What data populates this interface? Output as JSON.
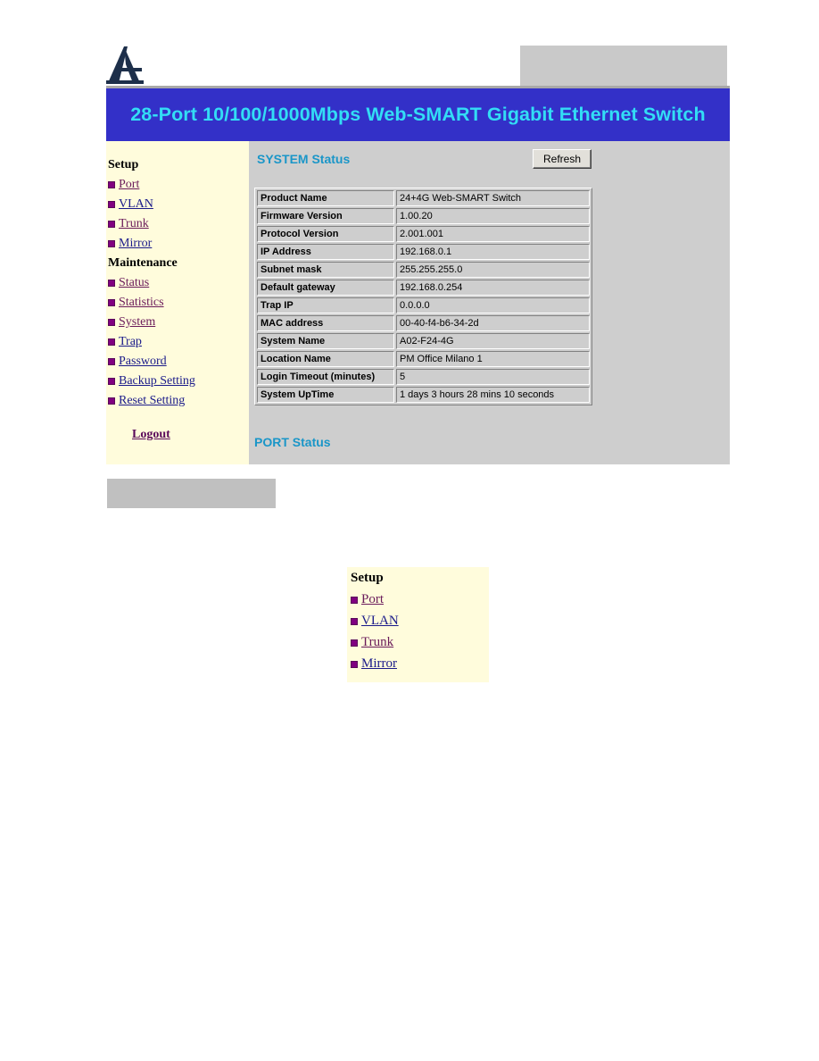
{
  "header": {
    "logo": "atlantis-land-logo",
    "title": "28-Port 10/100/1000Mbps Web-SMART Gigabit Ethernet Switch"
  },
  "colors": {
    "banner_bg": "#3330c8",
    "banner_text": "#33ddf5",
    "sidebar_bg": "#fffcdc",
    "main_bg": "#cecece",
    "section_title": "#1a96c8",
    "bullet": "#800080"
  },
  "sidebar": {
    "setup_heading": "Setup",
    "setup_items": [
      {
        "label": "Port"
      },
      {
        "label": "VLAN"
      },
      {
        "label": "Trunk"
      },
      {
        "label": "Mirror"
      }
    ],
    "maintenance_heading": "Maintenance",
    "maintenance_items": [
      {
        "label": "Status"
      },
      {
        "label": "Statistics"
      },
      {
        "label": "System"
      },
      {
        "label": "Trap"
      },
      {
        "label": "Password"
      },
      {
        "label": "Backup Setting"
      },
      {
        "label": "Reset Setting"
      }
    ],
    "logout_label": "Logout"
  },
  "main": {
    "system_status_title": "SYSTEM Status",
    "refresh_label": "Refresh",
    "status_rows": [
      {
        "key": "Product Name",
        "value": "24+4G Web-SMART Switch"
      },
      {
        "key": "Firmware Version",
        "value": "1.00.20"
      },
      {
        "key": "Protocol Version",
        "value": "2.001.001"
      },
      {
        "key": "IP Address",
        "value": "192.168.0.1"
      },
      {
        "key": "Subnet mask",
        "value": "255.255.255.0"
      },
      {
        "key": "Default gateway",
        "value": "192.168.0.254"
      },
      {
        "key": "Trap IP",
        "value": "0.0.0.0"
      },
      {
        "key": "MAC address",
        "value": "00-40-f4-b6-34-2d"
      },
      {
        "key": "System Name",
        "value": "A02-F24-4G"
      },
      {
        "key": "Location Name",
        "value": "PM Office Milano 1"
      },
      {
        "key": "Login Timeout (minutes)",
        "value": "5"
      },
      {
        "key": "System UpTime",
        "value": "1 days 3 hours 28 mins 10 seconds"
      }
    ],
    "port_status_title": "PORT Status"
  },
  "detail_panel": {
    "heading": "Setup",
    "items": [
      {
        "label": "Port"
      },
      {
        "label": "VLAN"
      },
      {
        "label": "Trunk"
      },
      {
        "label": "Mirror"
      }
    ]
  }
}
